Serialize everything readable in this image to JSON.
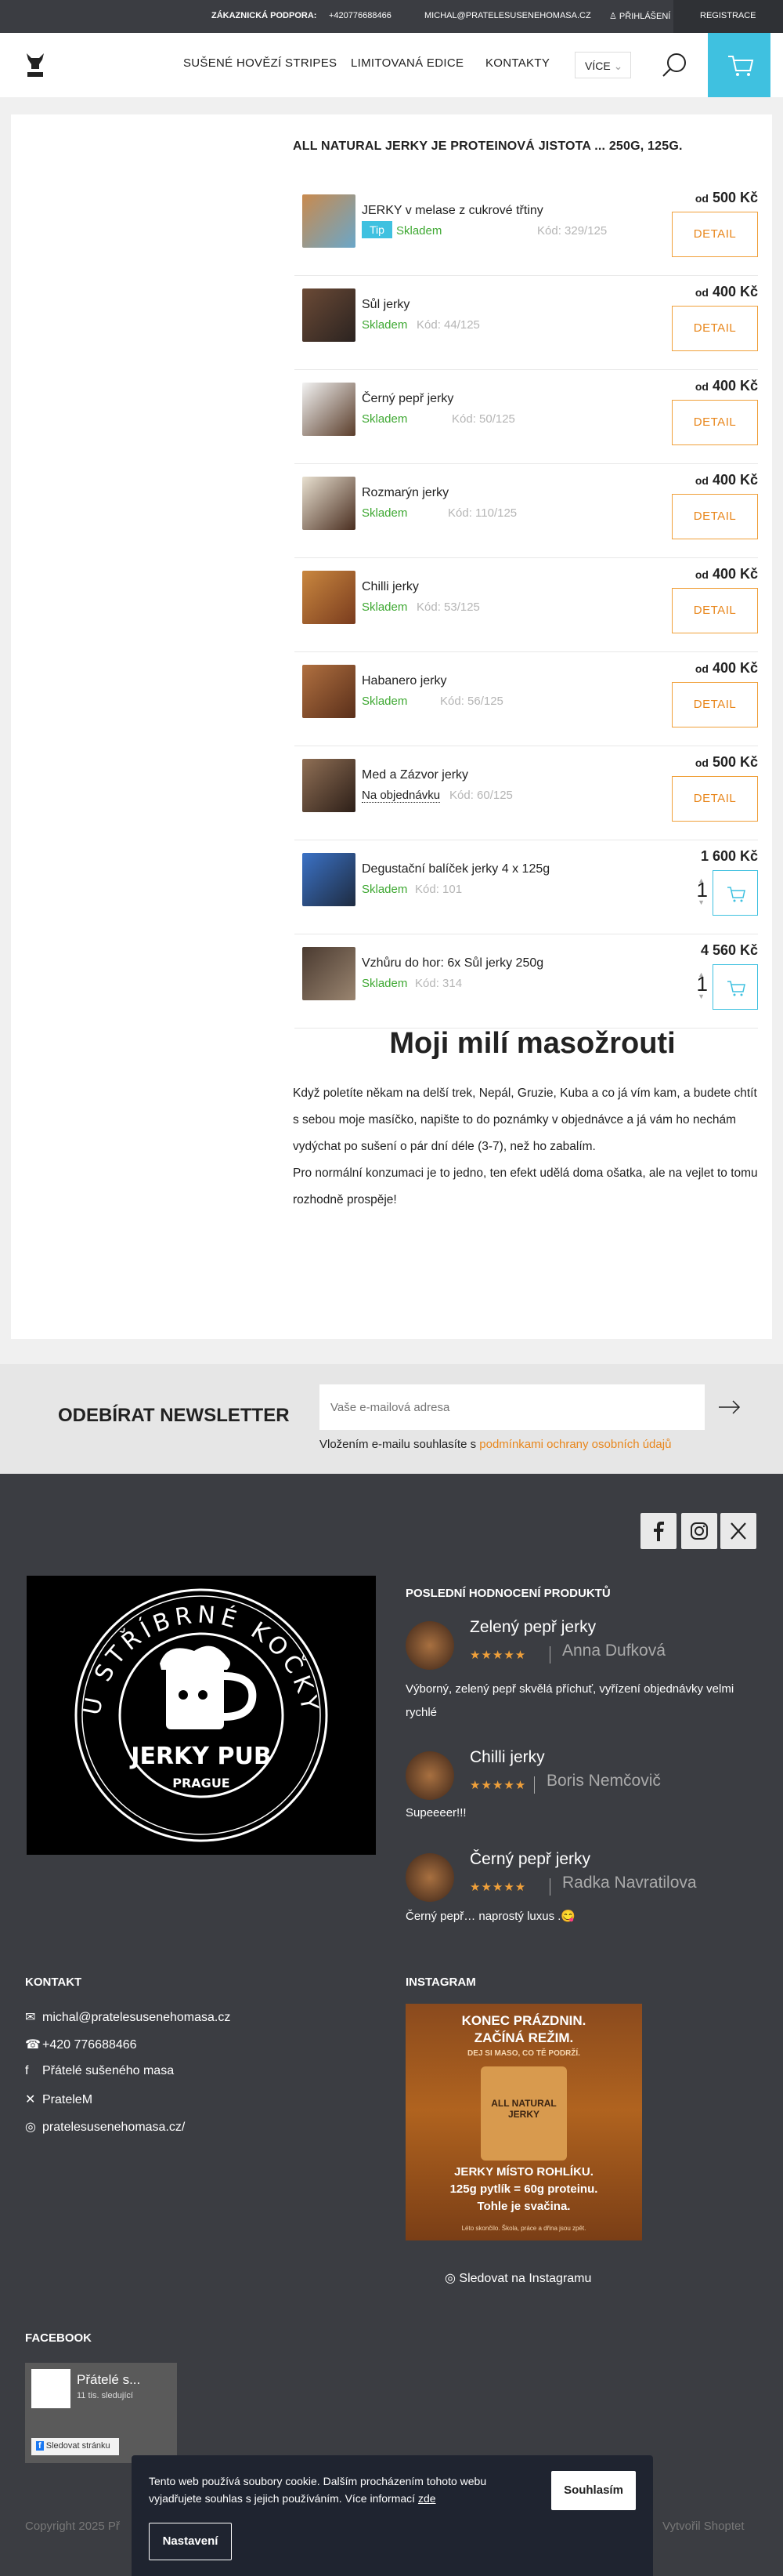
{
  "topbar": {
    "support_label": "ZÁKAZNICKÁ PODPORA:",
    "phone": "+420776688466",
    "email": "MICHAL@PRATELESUSENEHOMASA.CZ",
    "login": "PŘIHLÁŠENÍ",
    "register": "REGISTRACE"
  },
  "header": {
    "logo_text": "JERKY",
    "nav": [
      "SUŠENÉ HOVĚZÍ STRIPES",
      "LIMITOVANÁ EDICE",
      "KONTAKTY"
    ],
    "more_label": "VÍCE"
  },
  "main": {
    "heading": "ALL NATURAL JERKY JE PROTEINOVÁ JISTOTA ... 250G, 125G.",
    "products": [
      {
        "name": "JERKY v melase z cukrové třtiny",
        "tip": "Tip",
        "stock": "Skladem",
        "code": "Kód: 329/125",
        "price_prefix": "od",
        "price": "500 Kč",
        "action": "DETAIL"
      },
      {
        "name": "Sůl jerky",
        "stock": "Skladem",
        "code": "Kód: 44/125",
        "price_prefix": "od",
        "price": "400 Kč",
        "action": "DETAIL"
      },
      {
        "name": "Černý pepř jerky",
        "stock": "Skladem",
        "code": "Kód: 50/125",
        "price_prefix": "od",
        "price": "400 Kč",
        "action": "DETAIL"
      },
      {
        "name": "Rozmarýn jerky",
        "stock": "Skladem",
        "code": "Kód: 110/125",
        "price_prefix": "od",
        "price": "400 Kč",
        "action": "DETAIL"
      },
      {
        "name": "Chilli jerky",
        "stock": "Skladem",
        "code": "Kód: 53/125",
        "price_prefix": "od",
        "price": "400 Kč",
        "action": "DETAIL"
      },
      {
        "name": "Habanero jerky",
        "stock": "Skladem",
        "code": "Kód: 56/125",
        "price_prefix": "od",
        "price": "400 Kč",
        "action": "DETAIL"
      },
      {
        "name": "Med a Zázvor jerky",
        "stock": "Na objednávku",
        "code": "Kód: 60/125",
        "price_prefix": "od",
        "price": "500 Kč",
        "action": "DETAIL"
      },
      {
        "name": "Degustační balíček jerky 4 x 125g",
        "stock": "Skladem",
        "code": "Kód: 101",
        "price": "1 600 Kč",
        "qty": "1"
      },
      {
        "name": "Vzhůru do hor: 6x Sůl jerky 250g",
        "stock": "Skladem",
        "code": "Kód: 314",
        "price": "4 560 Kč",
        "qty": "1"
      }
    ],
    "article_title": "Moji milí masožrouti",
    "article_p1": "Když poletíte někam na delší trek, Nepál, Gruzie, Kuba a co já vím kam, a budete chtít s sebou moje masíčko, napište to do poznámky v objednávce a já vám ho nechám vydýchat po sušení o pár dní déle (3-7), než ho zabalím.",
    "article_p2": "Pro normální konzumaci je to jedno, ten efekt udělá doma ošatka, ale na vejlet to tomu rozhodně prospěje!"
  },
  "newsletter": {
    "title": "ODEBÍRAT NEWSLETTER",
    "placeholder": "Vaše e-mailová adresa",
    "consent_prefix": "Vložením e-mailu souhlasíte s",
    "consent_link": "podmínkami ochrany osobních údajů"
  },
  "footer": {
    "logo_ring_text": "U STŘÍBRNÉ KOČKY",
    "logo_main": "JERKY PUB",
    "logo_sub": "PRAGUE",
    "reviews_title": "POSLEDNÍ HODNOCENÍ PRODUKTŮ",
    "reviews": [
      {
        "product": "Zelený pepř jerky",
        "stars": "★★★★★",
        "author": "Anna Dufková",
        "text": "Výborný, zelený pepř skvělá příchuť, vyřízení objednávky velmi rychlé"
      },
      {
        "product": "Chilli jerky",
        "stars": "★★★★★",
        "author": "Boris Nemčovič",
        "text": "Supeeeer!!!"
      },
      {
        "product": "Černý pepř jerky",
        "stars": "★★★★★",
        "author": "Radka Navratilova",
        "text": "Černý pepř… naprostý luxus .😋"
      }
    ],
    "contact_title": "KONTAKT",
    "contacts": [
      "michal@pratelesusenehomasa.cz",
      "+420 776688466",
      "Přátelé sušeného masa",
      "PrateleM",
      "pratelesusenehomasa.cz/"
    ],
    "instagram_title": "INSTAGRAM",
    "insta_lines": [
      "KONEC PRÁZDNIN.",
      "ZAČÍNÁ REŽIM.",
      "DEJ SI MASO, CO TĚ PODRŽÍ.",
      "JERKY MÍSTO ROHLÍKU.",
      "125g pytlík = 60g proteinu.",
      "Tohle je svačina.",
      "Léto skončilo. Škola, práce a dřina jsou zpět."
    ],
    "insta_bag_label": "ALL NATURAL JERKY",
    "instagram_follow": "Sledovat na Instagramu",
    "facebook_title": "FACEBOOK",
    "fb_name": "Přátelé s...",
    "fb_followers": "11 tis. sledující",
    "fb_follow": "Sledovat stránku",
    "copyright": "Copyright 2025 Př",
    "shoptet": "Vytvořil Shoptet"
  },
  "cookie": {
    "text": "Tento web používá soubory cookie. Dalším procházením tohoto webu vyjadřujete souhlas s jejich používáním.",
    "more_prefix": "Více informací",
    "more_link": "zde",
    "accept": "Souhlasím",
    "settings": "Nastavení"
  },
  "colors": {
    "accent": "#3fc1e0",
    "orange": "#e8861b",
    "green": "#3ea832",
    "dark": "#3b3d42"
  }
}
